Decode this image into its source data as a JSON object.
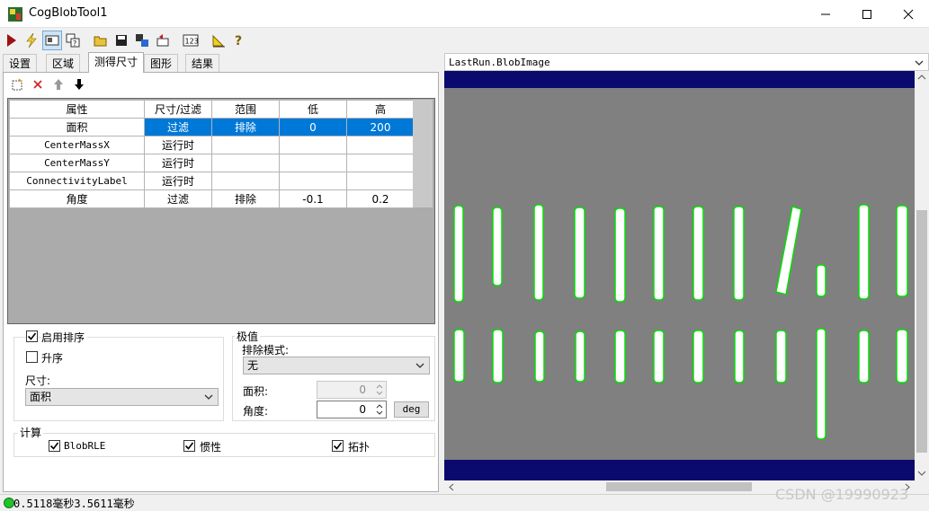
{
  "window": {
    "title": "CogBlobTool1"
  },
  "tabs": [
    "设置",
    "区域",
    "测得尺寸",
    "图形",
    "结果"
  ],
  "grid": {
    "headers": [
      "属性",
      "尺寸/过滤",
      "范围",
      "低",
      "高"
    ],
    "rows": [
      {
        "name": "面积",
        "mode": "过滤",
        "range": "排除",
        "low": "0",
        "high": "200",
        "selected": true
      },
      {
        "name": "CenterMassX",
        "mode": "运行时",
        "range": "",
        "low": "",
        "high": "",
        "selected": false
      },
      {
        "name": "CenterMassY",
        "mode": "运行时",
        "range": "",
        "low": "",
        "high": "",
        "selected": false
      },
      {
        "name": "ConnectivityLabel",
        "mode": "运行时",
        "range": "",
        "low": "",
        "high": "",
        "selected": false
      },
      {
        "name": "角度",
        "mode": "过滤",
        "range": "排除",
        "low": "-0.1",
        "high": "0.2",
        "selected": false
      }
    ]
  },
  "sort": {
    "enable_label": "启用排序",
    "enable_checked": true,
    "ascending_label": "升序",
    "ascending_checked": false,
    "size_label": "尺寸:",
    "size_value": "面积"
  },
  "extreme": {
    "group_label": "极值",
    "exclude_mode_label": "排除模式:",
    "exclude_mode_value": "无",
    "area_label": "面积:",
    "area_value": "0",
    "angle_label": "角度:",
    "angle_value": "0",
    "deg_button": "deg"
  },
  "compute": {
    "group_label": "计算",
    "options": [
      {
        "label": "BlobRLE",
        "checked": true
      },
      {
        "label": "惯性",
        "checked": true
      },
      {
        "label": "拓扑",
        "checked": true
      }
    ]
  },
  "image": {
    "title": "LastRun.BlobImage"
  },
  "status": {
    "text": "0.5118毫秒3.5611毫秒"
  },
  "watermark": "CSDN @19990923",
  "colors": {
    "selection": "#0078d7",
    "blob_outline": "#00e000",
    "image_band": "#0a0a6e",
    "status_led": "#22c22a"
  }
}
